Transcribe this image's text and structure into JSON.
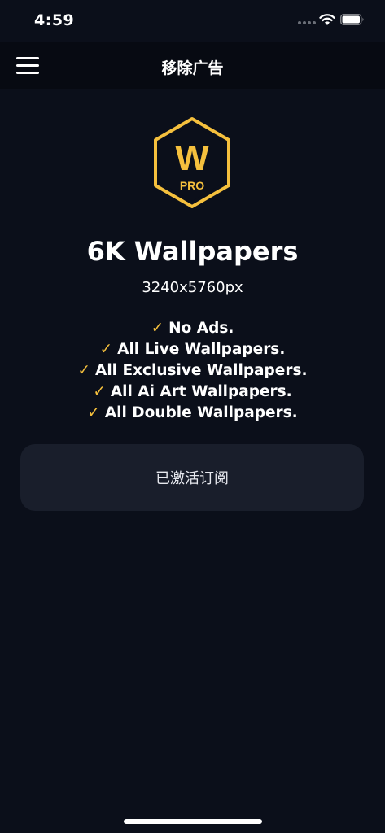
{
  "status_bar": {
    "time": "4:59",
    "icons": [
      "signal-icon",
      "wifi-icon",
      "battery-icon"
    ]
  },
  "nav": {
    "title": "移除广告",
    "menu_icon": "menu-icon"
  },
  "logo": {
    "letter": "W",
    "badge": "PRO",
    "color": "#f5c03d"
  },
  "app": {
    "title": "6K Wallpapers",
    "resolution": "3240x5760px"
  },
  "features": [
    {
      "check": "✓",
      "text": "No Ads."
    },
    {
      "check": "✓",
      "text": "All Live Wallpapers."
    },
    {
      "check": "✓",
      "text": "All Exclusive Wallpapers."
    },
    {
      "check": "✓",
      "text": "All Ai Art Wallpapers."
    },
    {
      "check": "✓",
      "text": "All Double Wallpapers."
    }
  ],
  "subscription": {
    "button_label": "已激活订阅"
  },
  "colors": {
    "background": "#0b0f1a",
    "accent": "#f5c03d",
    "button": "#191e2b"
  }
}
